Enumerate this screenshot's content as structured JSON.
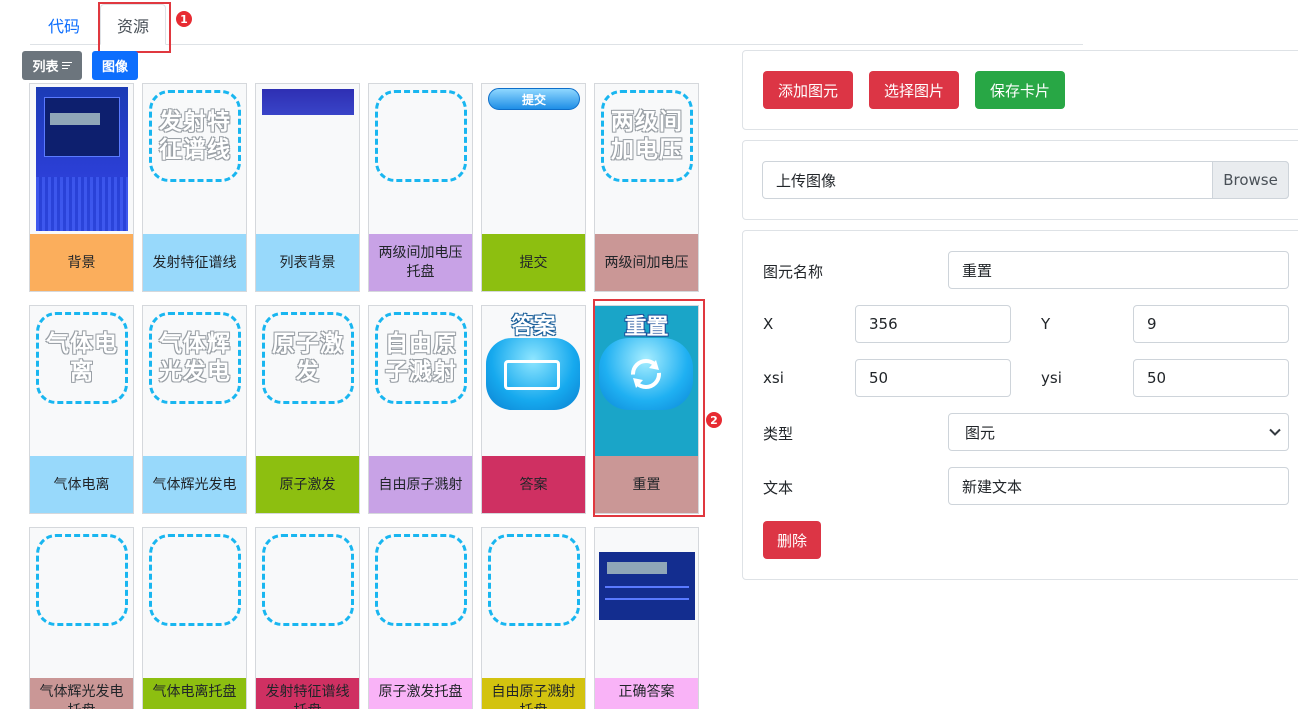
{
  "tabs": {
    "code": "代码",
    "resources": "资源"
  },
  "badges": {
    "one": "1",
    "two": "2"
  },
  "view": {
    "list": "列表",
    "image": "图像"
  },
  "cards": [
    {
      "thumb": "bg-screenshot",
      "label": "背景",
      "color": "#fbae5c"
    },
    {
      "thumb": "dashed",
      "thumb_text": "发射特征谱线",
      "label": "发射特征谱线",
      "color": "#98d9fb"
    },
    {
      "thumb": "blue-bar",
      "label": "列表背景",
      "color": "#98d9fb"
    },
    {
      "thumb": "dashed",
      "thumb_text": "",
      "label": "两级间加电压托盘",
      "color": "#c8a2e6"
    },
    {
      "thumb": "submit-button",
      "thumb_text": "提交",
      "label": "提交",
      "color": "#8dbf10"
    },
    {
      "thumb": "dashed",
      "thumb_text": "两级间加电压",
      "label": "两级间加电压",
      "color": "#ca9796"
    },
    {
      "thumb": "dashed",
      "thumb_text": "气体电离",
      "label": "气体电离",
      "color": "#98d9fb"
    },
    {
      "thumb": "dashed",
      "thumb_text": "气体辉光发电",
      "label": "气体辉光发电",
      "color": "#98d9fb"
    },
    {
      "thumb": "dashed",
      "thumb_text": "原子激发",
      "label": "原子激发",
      "color": "#8dbf10"
    },
    {
      "thumb": "dashed",
      "thumb_text": "自由原子溅射",
      "label": "自由原子溅射",
      "color": "#c8a2e6"
    },
    {
      "thumb": "answer-icon",
      "thumb_text": "答案",
      "label": "答案",
      "color": "#cf3062"
    },
    {
      "thumb": "reset-icon",
      "thumb_text": "重置",
      "label": "重置",
      "color": "#ca9796"
    },
    {
      "thumb": "dashed",
      "thumb_text": "",
      "label": "气体辉光发电托盘",
      "color": "#ca9796"
    },
    {
      "thumb": "dashed",
      "thumb_text": "",
      "label": "气体电离托盘",
      "color": "#8dbf10"
    },
    {
      "thumb": "dashed",
      "thumb_text": "",
      "label": "发射特征谱线托盘",
      "color": "#cf3062"
    },
    {
      "thumb": "dashed",
      "thumb_text": "",
      "label": "原子激发托盘",
      "color": "#f9b3f7"
    },
    {
      "thumb": "dashed",
      "thumb_text": "",
      "label": "自由原子溅射托盘",
      "color": "#d3c30f"
    },
    {
      "thumb": "answer-screenshot",
      "label": "正确答案",
      "color": "#f9b3f7"
    }
  ],
  "actions": {
    "add": "添加图元",
    "select": "选择图片",
    "save": "保存卡片"
  },
  "upload": {
    "placeholder": "上传图像",
    "browse": "Browse"
  },
  "form": {
    "name_label": "图元名称",
    "name_value": "重置",
    "x_label": "X",
    "x_value": "356",
    "y_label": "Y",
    "y_value": "9",
    "xsi_label": "xsi",
    "xsi_value": "50",
    "ysi_label": "ysi",
    "ysi_value": "50",
    "type_label": "类型",
    "type_value": "图元",
    "text_label": "文本",
    "text_value": "新建文本",
    "delete": "删除"
  },
  "colors": {
    "danger": "#dc3545",
    "success": "#28a745",
    "primary": "#0d6efd",
    "highlight": "#e0383f"
  }
}
